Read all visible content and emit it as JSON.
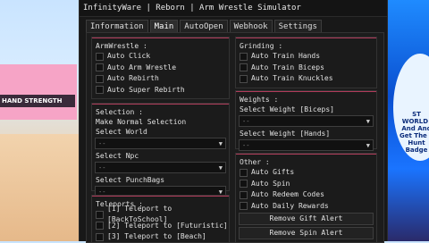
{
  "window": {
    "title": "InfinityWare | Reborn | Arm Wrestle Simulator"
  },
  "tabs": [
    "Information",
    "Main",
    "AutoOpen",
    "Webhook",
    "Settings"
  ],
  "active_tab": "Main",
  "background": {
    "banner_text": "HAND STRENGTH",
    "world_label": "ST WORLD! And And Get The a Hunt Badge"
  },
  "armwrestle": {
    "title": "ArmWrestle :",
    "items": [
      "Auto Click",
      "Auto Arm Wrestle",
      "Auto Rebirth",
      "Auto Super Rebirth"
    ]
  },
  "selection": {
    "title": "Selection :",
    "make_normal": "Make Normal Selection",
    "world_label": "Select World",
    "world_value": "--",
    "npc_label": "Select Npc",
    "npc_value": "--",
    "punchbags_label": "Select PunchBags",
    "punchbags_value": "--"
  },
  "teleports": {
    "title": "Teleports :",
    "items": [
      "[1] Teleport to [BackToSchool]",
      "[2] Teleport to [Futuristic]",
      "[3] Teleport to [Beach]"
    ]
  },
  "grinding": {
    "title": "Grinding :",
    "items": [
      "Auto Train Hands",
      "Auto Train Biceps",
      "Auto Train Knuckles"
    ]
  },
  "weights": {
    "title": "Weights :",
    "biceps_label": "Select Weight [Biceps]",
    "biceps_value": "--",
    "hands_label": "Select Weight [Hands]",
    "hands_value": "--"
  },
  "other": {
    "title": "Other :",
    "items": [
      "Auto Gifts",
      "Auto Spin",
      "Auto Redeem Codes",
      "Auto Daily Rewards"
    ],
    "buttons": [
      "Remove Gift Alert",
      "Remove Spin Alert"
    ]
  },
  "colors": {
    "accent": "#b03b5a",
    "window_bg": "#181818"
  }
}
